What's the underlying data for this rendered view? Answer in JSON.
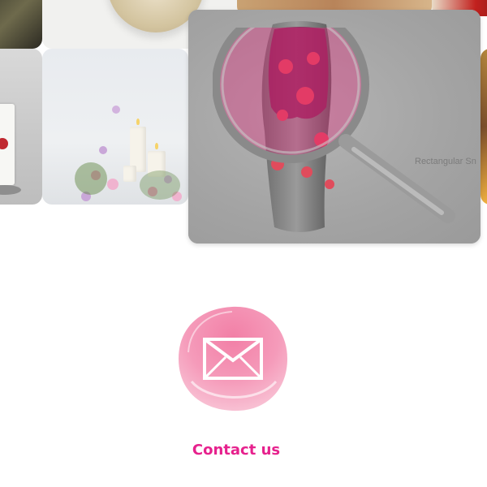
{
  "preview": {
    "snip_label": "Rectangular Sn"
  },
  "contact": {
    "label": "Contact us",
    "icon": "envelope-icon"
  },
  "colors": {
    "accent": "#e6218d",
    "badge_pink": "#f4709d",
    "overlay_gray": "#a9a9a9"
  }
}
